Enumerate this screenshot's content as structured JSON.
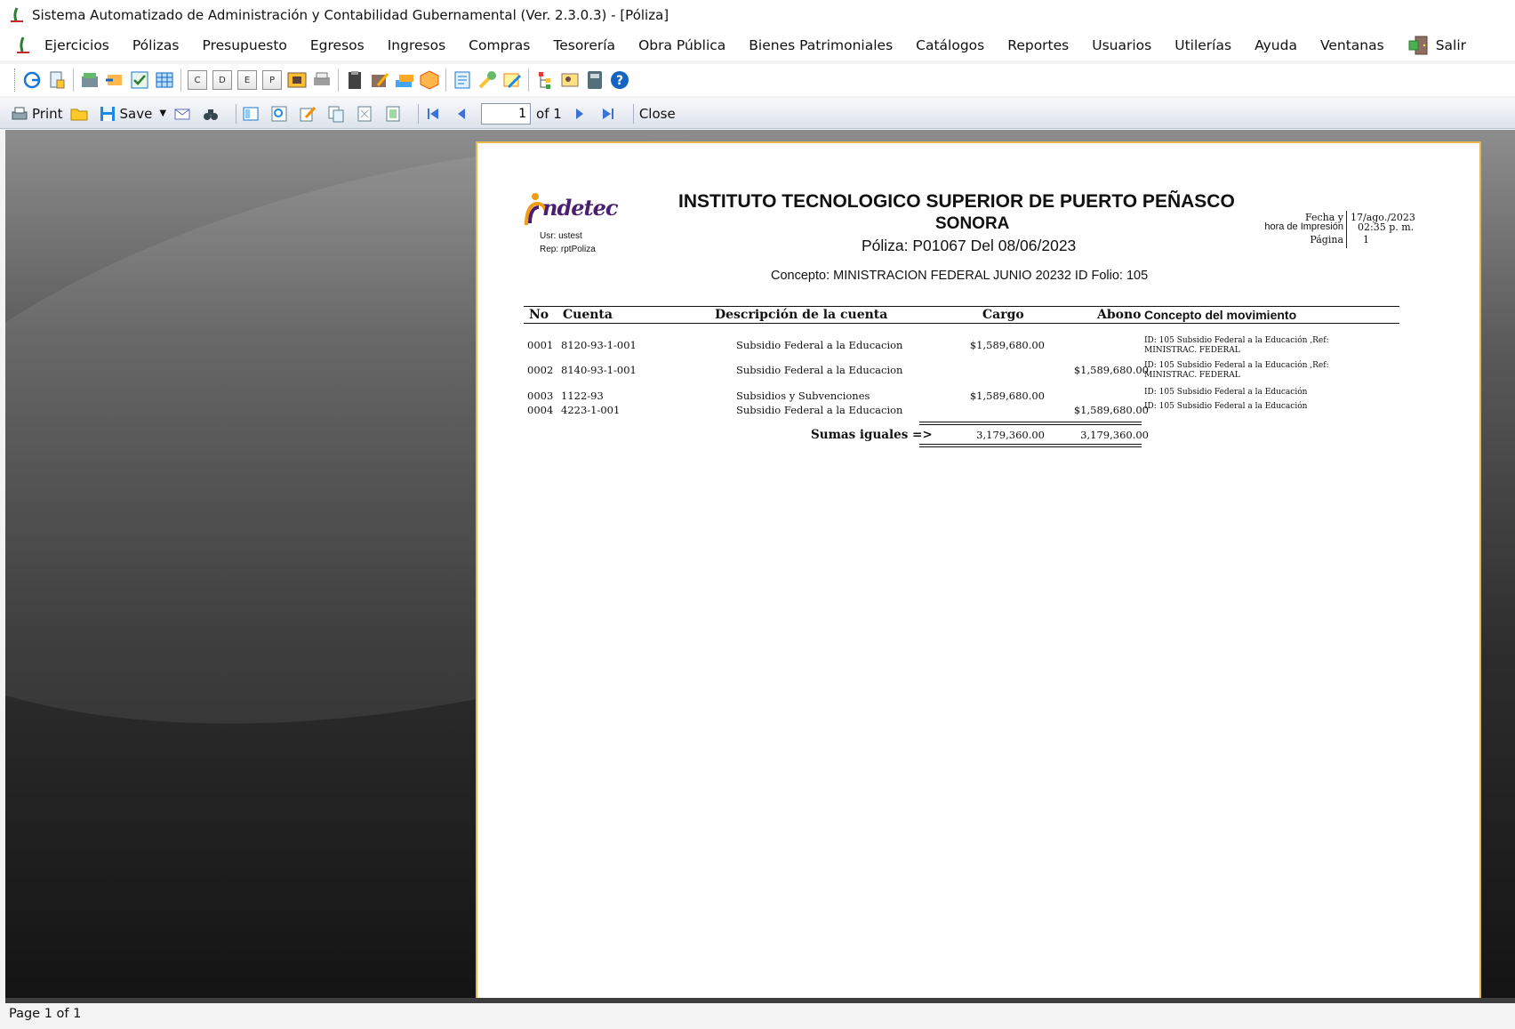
{
  "window": {
    "title": "Sistema Automatizado de Administración y Contabilidad Gubernamental  (Ver. 2.3.0.3) - [Póliza]"
  },
  "menu": {
    "items": [
      "Ejercicios",
      "Pólizas",
      "Presupuesto",
      "Egresos",
      "Ingresos",
      "Compras",
      "Tesorería",
      "Obra Pública",
      "Bienes Patrimoniales",
      "Catálogos",
      "Reportes",
      "Usuarios",
      "Utilerías",
      "Ayuda",
      "Ventanas"
    ],
    "exit_label": "Salir"
  },
  "toolbar": {
    "letter_buttons": [
      "C",
      "D",
      "E",
      "P"
    ]
  },
  "viewer_toolbar": {
    "print_label": "Print",
    "save_label": "Save",
    "page_value": "1",
    "of_label": "of 1",
    "close_label": "Close"
  },
  "report": {
    "logo_text": "ndetec",
    "user_line": "Usr: ustest",
    "report_line": "Rep: rptPoliza",
    "institution": "INSTITUTO TECNOLOGICO SUPERIOR DE PUERTO PEÑASCO",
    "state": "SONORA",
    "poliza_line": "Póliza:  P01067  Del 08/06/2023",
    "concepto_line": "Concepto: MINISTRACION FEDERAL JUNIO 20232 ID Folio: 105",
    "fecha_labels": [
      "Fecha y",
      "hora de Impresión",
      "Página"
    ],
    "fecha_values": [
      "17/ago./2023",
      "02:35 p. m.",
      "1"
    ],
    "columns": {
      "no": "No",
      "cuenta": "Cuenta",
      "descripcion": "Descripción de la cuenta",
      "cargo": "Cargo",
      "abono": "Abono",
      "concepto": "Concepto del movimiento"
    },
    "rows": [
      {
        "no": "0001",
        "cuenta": "8120-93-1-001",
        "descripcion": "Subsidio Federal a la Educacion",
        "cargo": "$1,589,680.00",
        "abono": "",
        "concepto": "ID: 105 Subsidio Federal a la Educación ,Ref: MINISTRAC. FEDERAL"
      },
      {
        "no": "0002",
        "cuenta": "8140-93-1-001",
        "descripcion": "Subsidio Federal a la Educacion",
        "cargo": "",
        "abono": "$1,589,680.00",
        "concepto": "ID: 105 Subsidio Federal a la Educación ,Ref: MINISTRAC. FEDERAL"
      },
      {
        "no": "0003",
        "cuenta": "1122-93",
        "descripcion": "Subsidios y Subvenciones",
        "cargo": "$1,589,680.00",
        "abono": "",
        "concepto": "ID: 105 Subsidio Federal a la Educación"
      },
      {
        "no": "0004",
        "cuenta": "4223-1-001",
        "descripcion": "Subsidio Federal a la Educacion",
        "cargo": "",
        "abono": "$1,589,680.00",
        "concepto": "ID: 105 Subsidio Federal a la Educación"
      }
    ],
    "totals": {
      "label": "Sumas iguales =>",
      "cargo": "3,179,360.00",
      "abono": "3,179,360.00"
    }
  },
  "status": {
    "text": "Page 1 of 1"
  },
  "colors": {
    "page_border": "#e4b94a",
    "logo_purple": "#4b1f6f",
    "logo_orange": "#f39c12"
  }
}
